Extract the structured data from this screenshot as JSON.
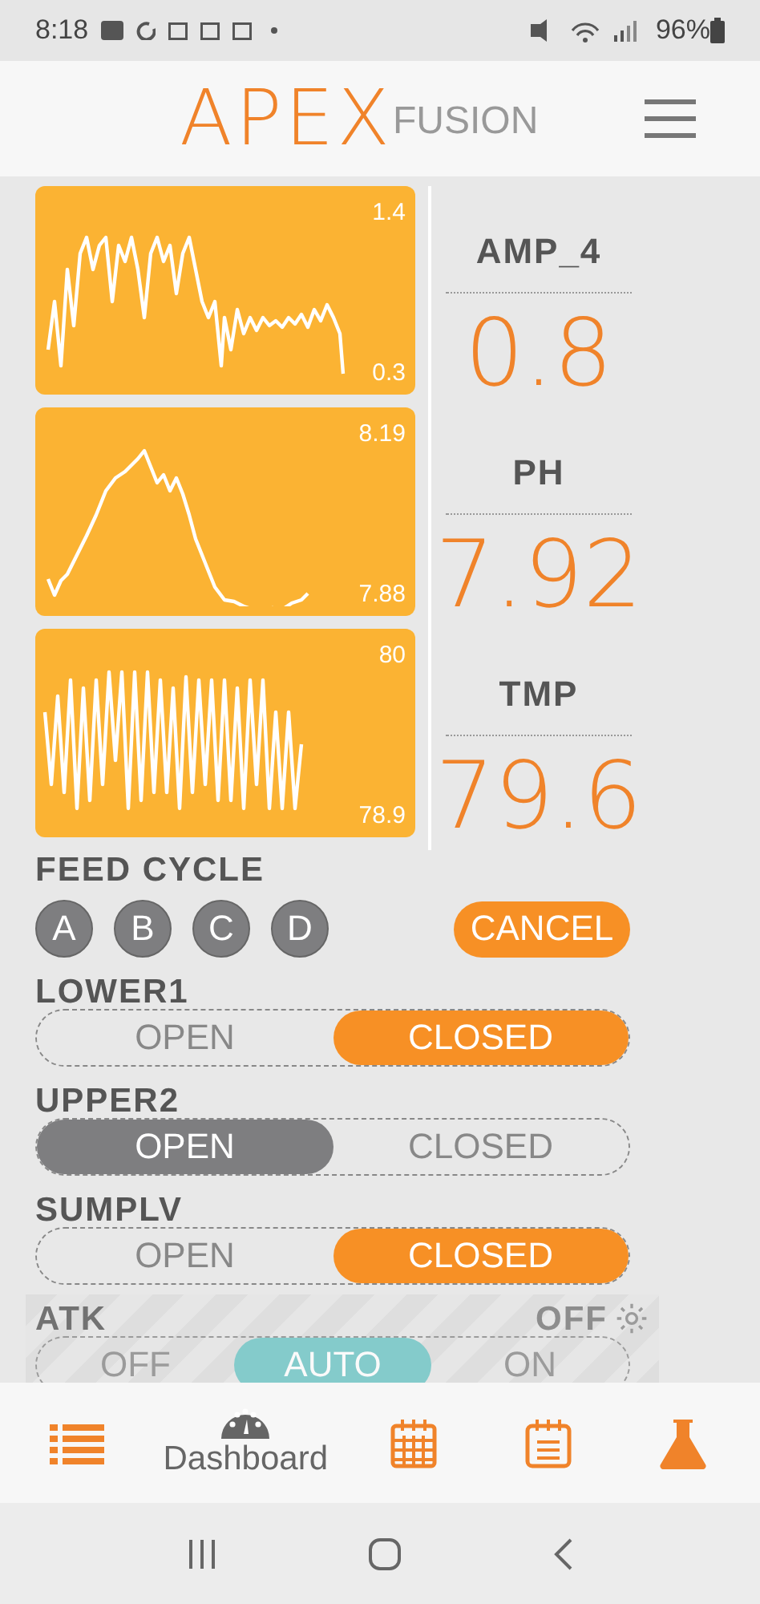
{
  "status_bar": {
    "time": "8:18",
    "battery": "96%"
  },
  "header": {
    "logo_main": "APEX",
    "logo_sub": "FUSION"
  },
  "probes": [
    {
      "name": "AMP_4",
      "value": "0.8",
      "max": "1.4",
      "min": "0.3"
    },
    {
      "name": "PH",
      "value": "7.92",
      "max": "8.19",
      "min": "7.88"
    },
    {
      "name": "TMP",
      "value": "79.6",
      "max": "80",
      "min": "78.9"
    }
  ],
  "feed_cycle": {
    "label": "FEED CYCLE",
    "buttons": [
      "A",
      "B",
      "C",
      "D"
    ],
    "cancel": "CANCEL"
  },
  "outlets": [
    {
      "name": "LOWER1",
      "disabled": false,
      "options": [
        {
          "label": "OPEN",
          "selected": false
        },
        {
          "label": "CLOSED",
          "selected": true
        }
      ]
    },
    {
      "name": "UPPER2",
      "disabled": false,
      "options": [
        {
          "label": "OPEN",
          "selected": true
        },
        {
          "label": "CLOSED",
          "selected": false
        }
      ]
    },
    {
      "name": "SUMPLV",
      "disabled": false,
      "options": [
        {
          "label": "OPEN",
          "selected": false
        },
        {
          "label": "CLOSED",
          "selected": true
        }
      ]
    },
    {
      "name": "ATK",
      "disabled": true,
      "status": "OFF",
      "options": [
        {
          "label": "OFF",
          "selected": false
        },
        {
          "label": "AUTO",
          "selected": true
        },
        {
          "label": "ON",
          "selected": false
        }
      ]
    }
  ],
  "bottom_nav": [
    {
      "kind": "list",
      "selected": false
    },
    {
      "kind": "dashboard",
      "label": "Dashboard",
      "selected": true
    },
    {
      "kind": "calendar",
      "selected": false
    },
    {
      "kind": "notes",
      "selected": false
    },
    {
      "kind": "flask",
      "selected": false
    }
  ]
}
